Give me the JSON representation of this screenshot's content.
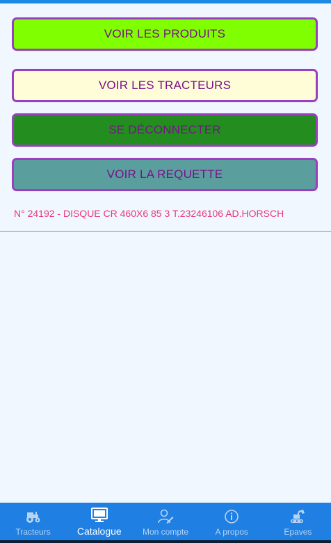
{
  "buttons": {
    "products_label": "VOIR LES PRODUITS",
    "tractors_label": "VOIR LES TRACTEURS",
    "logout_label": "SE DÉCONNECTER",
    "query_label": "VOIR LA REQUETTE"
  },
  "result": {
    "text": "N° 24192 - DISQUE CR 460X6 85 3 T.23246106 AD.HORSCH"
  },
  "colors": {
    "accent": "#1f7fe2",
    "button_border": "#9b3fc1",
    "button_text": "#7a108a",
    "result_text": "#e8367a"
  },
  "nav": {
    "active": "Catalogue",
    "items": [
      {
        "label": "Tracteurs",
        "icon": "tractor-icon"
      },
      {
        "label": "Catalogue",
        "icon": "monitor-icon"
      },
      {
        "label": "Mon compte",
        "icon": "user-edit-icon"
      },
      {
        "label": "A propos",
        "icon": "info-icon"
      },
      {
        "label": "Epaves",
        "icon": "excavator-icon"
      }
    ]
  }
}
